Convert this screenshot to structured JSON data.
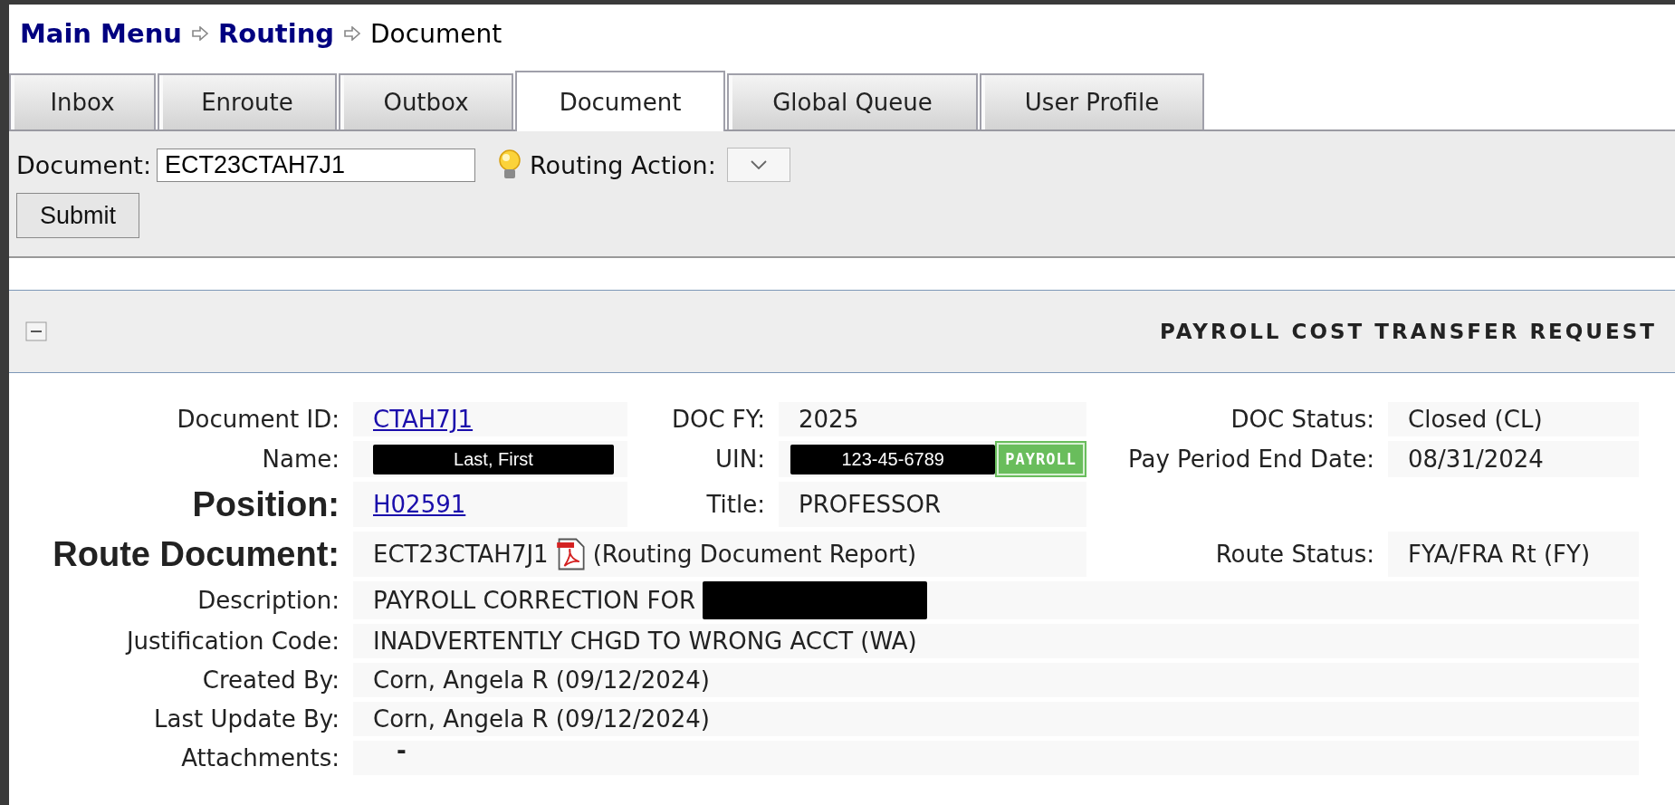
{
  "breadcrumb": [
    {
      "label": "Main Menu",
      "kind": "link"
    },
    {
      "label": "Routing",
      "kind": "link"
    },
    {
      "label": "Document",
      "kind": "current"
    }
  ],
  "tabs": [
    {
      "label": "Inbox",
      "selected": false
    },
    {
      "label": "Enroute",
      "selected": false
    },
    {
      "label": "Outbox",
      "selected": false
    },
    {
      "label": "Document",
      "selected": true
    },
    {
      "label": "Global Queue",
      "selected": false
    },
    {
      "label": "User Profile",
      "selected": false
    }
  ],
  "toolbar": {
    "document_label": "Document:",
    "document_value": "ECT23CTAH7J1",
    "routing_action_label": "Routing Action:",
    "submit": "Submit"
  },
  "section": {
    "title": "PAYROLL COST TRANSFER REQUEST",
    "expanded": true
  },
  "rows": [
    {
      "kind": "three",
      "strong": false,
      "cells": [
        {
          "label": "Document ID:",
          "value": "CTAH7J1",
          "kind": "link"
        },
        {
          "label": "DOC FY:",
          "value": "2025",
          "kind": "text"
        },
        {
          "label": "DOC Status:",
          "value": "Closed (CL)",
          "kind": "text"
        }
      ]
    },
    {
      "kind": "three",
      "strong": false,
      "cells": [
        {
          "label": "Name:",
          "value": "Last, First",
          "kind": "redacted"
        },
        {
          "label": "UIN:",
          "value": "123-45-6789",
          "kind": "redacted",
          "badge": "PAYROLL"
        },
        {
          "label": "Pay Period End Date:",
          "value": "08/31/2024",
          "kind": "text"
        }
      ]
    },
    {
      "kind": "two",
      "strong": true,
      "cells": [
        {
          "label": "Position:",
          "value": "H02591",
          "kind": "link"
        },
        {
          "label": "Title:",
          "value": "PROFESSOR",
          "kind": "text"
        }
      ]
    },
    {
      "kind": "wide",
      "strong": true,
      "cells": [
        {
          "label": "Route Document:",
          "value": "ECT23CTAH7J1",
          "kind": "pdf",
          "note": "(Routing Document Report)"
        },
        {
          "label": "Route Status:",
          "value": "FYA/FRA Rt (FY)",
          "kind": "text"
        }
      ]
    },
    {
      "kind": "full",
      "strong": false,
      "cells": [
        {
          "label": "Description:",
          "value": "PAYROLL CORRECTION FOR",
          "kind": "redacted-tail"
        }
      ]
    },
    {
      "kind": "full",
      "strong": false,
      "cells": [
        {
          "label": "Justification Code:",
          "value": "INADVERTENTLY CHGD TO WRONG ACCT (WA)",
          "kind": "text"
        }
      ]
    },
    {
      "kind": "full",
      "strong": false,
      "cells": [
        {
          "label": "Created By:",
          "value": "Corn, Angela R (09/12/2024)",
          "kind": "text"
        }
      ]
    },
    {
      "kind": "full",
      "strong": false,
      "cells": [
        {
          "label": "Last Update By:",
          "value": "Corn, Angela R (09/12/2024)",
          "kind": "text"
        }
      ]
    },
    {
      "kind": "full",
      "strong": false,
      "cells": [
        {
          "label": "Attachments:",
          "value": "-",
          "kind": "dash"
        }
      ]
    }
  ]
}
